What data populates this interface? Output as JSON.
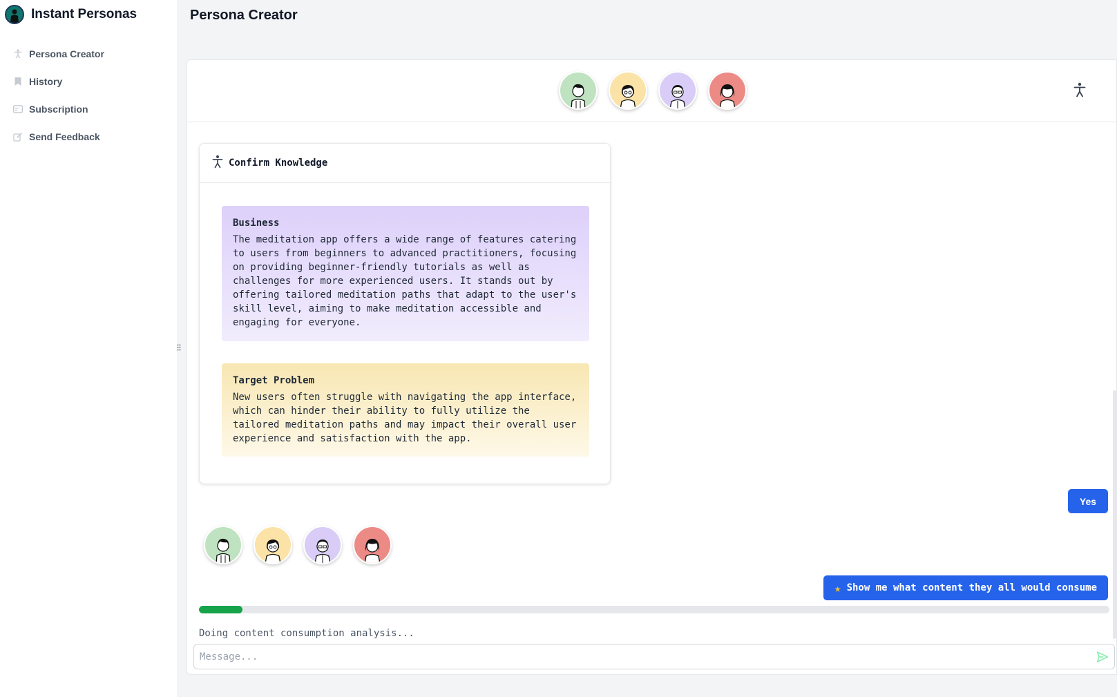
{
  "app": {
    "title": "Instant Personas"
  },
  "sidebar": {
    "items": [
      {
        "label": "Persona Creator",
        "icon": "person-icon"
      },
      {
        "label": "History",
        "icon": "bookmark-icon"
      },
      {
        "label": "Subscription",
        "icon": "card-icon"
      },
      {
        "label": "Send Feedback",
        "icon": "pencil-icon"
      }
    ]
  },
  "header": {
    "title": "Persona Creator"
  },
  "personas": [
    {
      "color": "#bfe3c0",
      "icon": "persona-avatar-1"
    },
    {
      "color": "#fbe3a8",
      "icon": "persona-avatar-2"
    },
    {
      "color": "#d9ccf7",
      "icon": "persona-avatar-3"
    },
    {
      "color": "#ec8a86",
      "icon": "persona-avatar-4"
    }
  ],
  "card": {
    "title": "Confirm Knowledge",
    "business": {
      "title": "Business",
      "text": "The meditation app offers a wide range of features catering to users from beginners to advanced practitioners, focusing on providing beginner-friendly tutorials as well as challenges for more experienced users. It stands out by offering tailored meditation paths that adapt to the user's skill level, aiming to make meditation accessible and engaging for everyone."
    },
    "problem": {
      "title": "Target Problem",
      "text": "New users often struggle with navigating the app interface, which can hinder their ability to fully utilize the tailored meditation paths and may impact their overall user experience and satisfaction with the app."
    }
  },
  "chat": {
    "reply_yes": "Yes",
    "action_label": "Show me what content they all would consume",
    "action_icon": "star-icon"
  },
  "progress": {
    "value": 0.048,
    "color": "#16a34a"
  },
  "status": {
    "text": "Doing content consumption analysis..."
  },
  "message_input": {
    "placeholder": "Message..."
  },
  "colors": {
    "accent": "#2563eb",
    "send": "#86efac"
  }
}
